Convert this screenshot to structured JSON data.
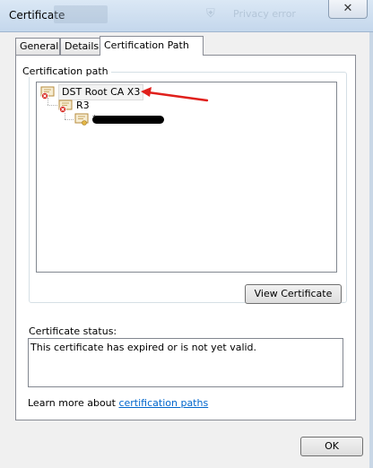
{
  "window": {
    "title": "Certificate",
    "close_glyph": "✕"
  },
  "background_ghost": {
    "text": "Privacy error"
  },
  "tabs": [
    {
      "label": "General"
    },
    {
      "label": "Details"
    },
    {
      "label": "Certification Path",
      "selected": true
    }
  ],
  "path_group": {
    "label": "Certification path"
  },
  "tree": [
    {
      "label": "DST Root CA X3",
      "state": "error",
      "selected": true
    },
    {
      "label": "R3",
      "state": "error"
    },
    {
      "label": "*",
      "state": "ok",
      "redacted": true
    }
  ],
  "buttons": {
    "view_certificate": "View Certificate",
    "ok": "OK"
  },
  "status": {
    "label": "Certificate status:",
    "text": "This certificate has expired or is not yet valid."
  },
  "learn_more": {
    "prefix": "Learn more about ",
    "link": "certification paths"
  },
  "colors": {
    "link": "#0066cc",
    "annotation_arrow": "#e0201c",
    "error_badge": "#d7261e"
  }
}
